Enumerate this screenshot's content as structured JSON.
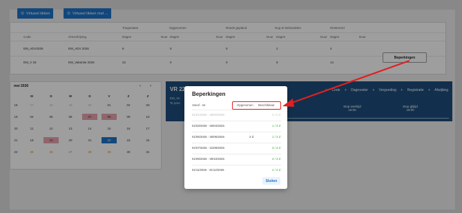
{
  "toolbar": {
    "virtual_btn": "Virtueel tikken",
    "virtual_with_btn": "Virtueel tikken met ..."
  },
  "balances": {
    "group_headers": [
      "Toegestaan",
      "Opgenomen",
      "Reeds gepland",
      "Nog te behandelen",
      "Resterend"
    ],
    "sub_headers": {
      "code": "Code",
      "description": "Omschrijving",
      "days": "Dagen",
      "duration": "Duur"
    },
    "rows": [
      {
        "code": "EM_ADV2026",
        "description": "EM_ADV 2026",
        "allowed": "6",
        "taken": "0",
        "planned": "0",
        "pending": "2",
        "remaining": "4"
      },
      {
        "code": "EM_V 26",
        "description": "EM_Vakantie 2026",
        "allowed": "22",
        "taken": "0",
        "planned": "0",
        "pending": "8",
        "remaining": "14"
      }
    ],
    "restrictions_button": "Beperkingen"
  },
  "calendar": {
    "month": "mei 2026",
    "prev": "‹",
    "next": "›",
    "weekdays": [
      "M",
      "D",
      "W",
      "D",
      "V",
      "Z",
      "Z"
    ],
    "weeks": [
      {
        "wk": "18",
        "days": [
          "27",
          "28",
          "29",
          "30",
          "01",
          "02",
          "03"
        ]
      },
      {
        "wk": "19",
        "days": [
          "04",
          "05",
          "06",
          "07",
          "08",
          "09",
          "10"
        ]
      },
      {
        "wk": "20",
        "days": [
          "11",
          "12",
          "13",
          "14",
          "15",
          "16",
          "17"
        ]
      },
      {
        "wk": "21",
        "days": [
          "18",
          "19",
          "20",
          "21",
          "22",
          "23",
          "24"
        ]
      },
      {
        "wk": "22",
        "days": [
          "25",
          "26",
          "27",
          "28",
          "29",
          "30",
          "31"
        ]
      }
    ]
  },
  "day_panel": {
    "title": "VR 22",
    "line1": "EM_Ve",
    "line2": "Te pres",
    "menu": [
      "Code",
      "Dagrooster",
      "Vergoeding",
      "Registratie",
      "Afwijking"
    ],
    "stamp_out_label": "Stop werktijd",
    "stamp_out_time": "16:00",
    "stamp_in_label": "Stop glijtijd",
    "stamp_in_time": "19:00"
  },
  "modal": {
    "title": "Beperkingen",
    "col_period": "Vanaf - tot",
    "col_taken": "Opgenomen",
    "col_available": "Beschikbaar",
    "rows": [
      {
        "range": "01/01/2026 - 28/02/2026",
        "taken": "",
        "available": "2 / 2 d",
        "muted": true
      },
      {
        "range": "01/03/2026 - 30/04/2026",
        "taken": "",
        "available": "1 / 3 d",
        "muted": false
      },
      {
        "range": "01/05/2026 - 30/06/2026",
        "taken": "2 d",
        "available": "1 / 3 d",
        "muted": false
      },
      {
        "range": "01/07/2026 - 31/08/2026",
        "taken": "",
        "available": "3 / 3 d",
        "muted": false
      },
      {
        "range": "01/09/2026 - 30/10/2026",
        "taken": "",
        "available": "3 / 3 d",
        "muted": false
      },
      {
        "range": "01/11/2026 - 31/12/2026",
        "taken": "",
        "available": "4 / 4 d",
        "muted": false
      }
    ],
    "close_button": "Sluiten"
  },
  "colors": {
    "accent": "#1e73c8",
    "header_dark": "#1d4e7c",
    "available_green": "#3aa835",
    "annotation_red": "#e02020"
  }
}
